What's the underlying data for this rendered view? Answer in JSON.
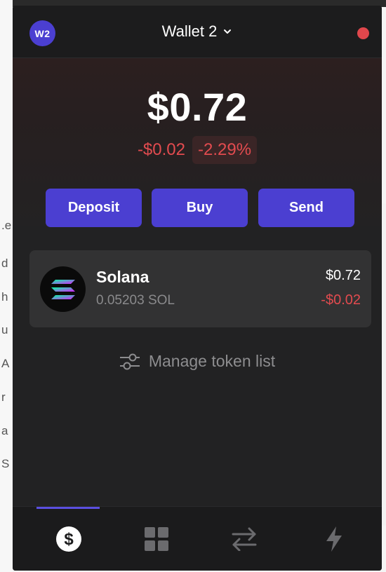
{
  "background": {
    "left_chars": [
      ".e",
      "d",
      "h",
      "u",
      "A",
      "r",
      "a",
      "S"
    ]
  },
  "header": {
    "avatar_initials": "W2",
    "wallet_name": "Wallet 2",
    "status_color": "#e0474c"
  },
  "balance": {
    "total": "$0.72",
    "change_usd": "-$0.02",
    "change_pct": "-2.29%"
  },
  "actions": {
    "deposit": "Deposit",
    "buy": "Buy",
    "send": "Send"
  },
  "tokens": [
    {
      "name": "Solana",
      "amount": "0.05203 SOL",
      "value_usd": "$0.72",
      "change_usd": "-$0.02",
      "icon": "solana-logo-icon"
    }
  ],
  "manage_label": "Manage token list",
  "tabs": [
    {
      "icon": "dollar-icon",
      "active": true
    },
    {
      "icon": "grid-icon",
      "active": false
    },
    {
      "icon": "swap-arrows-icon",
      "active": false
    },
    {
      "icon": "lightning-icon",
      "active": false
    }
  ],
  "colors": {
    "accent": "#4b3fd1",
    "negative": "#e24b4f",
    "panel": "#222223",
    "card": "#323233"
  }
}
